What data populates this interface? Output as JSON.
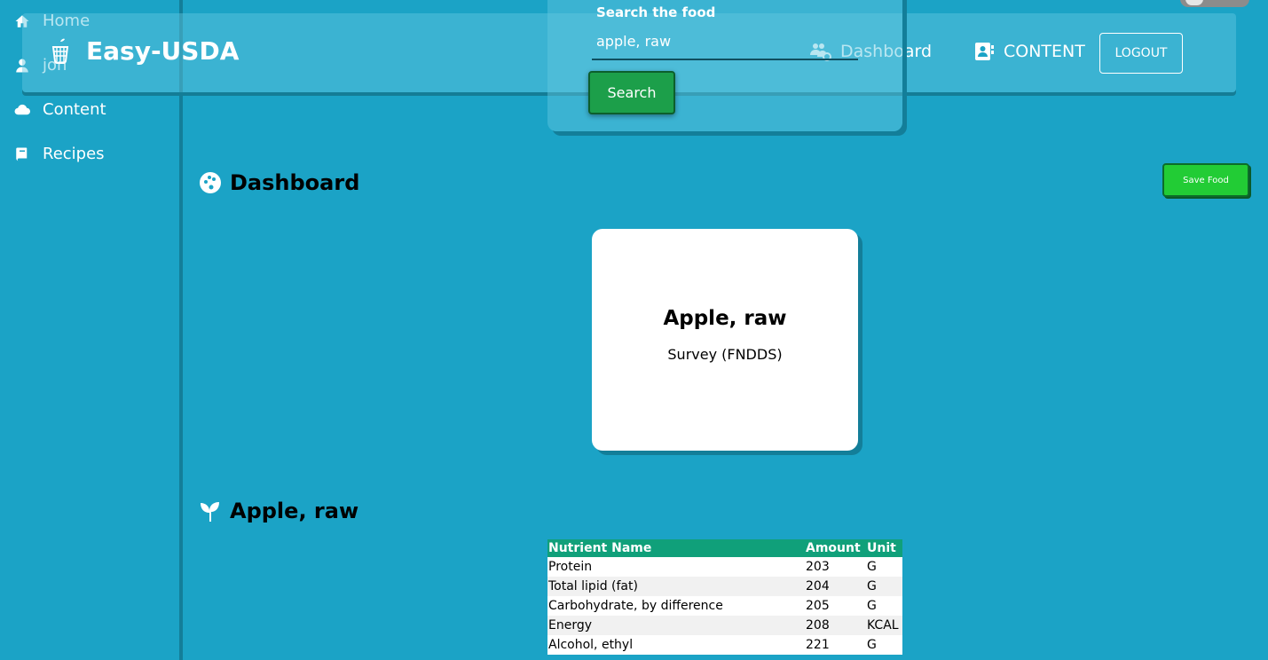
{
  "sidebar": {
    "items": [
      {
        "label": "Home",
        "icon": "home-icon"
      },
      {
        "label": "jon",
        "icon": "user-icon"
      },
      {
        "label": "Content",
        "icon": "cloud-icon"
      },
      {
        "label": "Recipes",
        "icon": "book-icon"
      }
    ]
  },
  "navbar": {
    "brand": "Easy-USDA",
    "links": [
      {
        "label": "Dashboard",
        "icon": "users-cog-icon"
      },
      {
        "label": "CONTENT",
        "icon": "contact-card-icon"
      }
    ],
    "logout_label": "LOGOUT"
  },
  "search": {
    "label": "Search the food",
    "value": "apple, raw",
    "button_label": "Search"
  },
  "dashboard": {
    "title": "Dashboard",
    "save_label": "Save Food"
  },
  "food_card": {
    "name": "Apple, raw",
    "data_type": "Survey (FNDDS)"
  },
  "food_section": {
    "title": "Apple, raw"
  },
  "nutrients": {
    "headers": [
      "Nutrient Name",
      "Amount",
      "Unit"
    ],
    "rows": [
      [
        "Protein",
        "203",
        "G"
      ],
      [
        "Total lipid (fat)",
        "204",
        "G"
      ],
      [
        "Carbohydrate, by difference",
        "205",
        "G"
      ],
      [
        "Energy",
        "208",
        "KCAL"
      ],
      [
        "Alcohol, ethyl",
        "221",
        "G"
      ]
    ]
  },
  "colors": {
    "background": "#1ba3c6",
    "search_button": "#1c9f4a",
    "save_button": "#22cc35",
    "table_header": "#10a07a"
  }
}
